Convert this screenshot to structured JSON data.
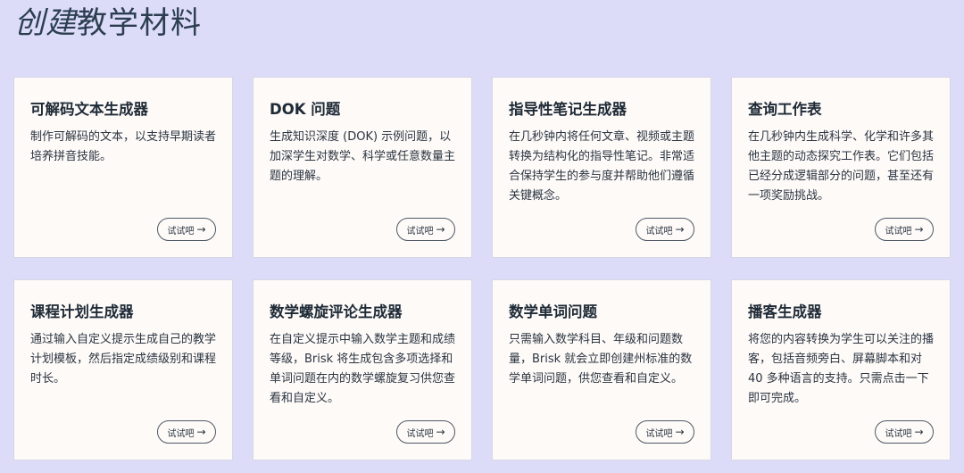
{
  "header": {
    "title_italic": "创建",
    "title_rest": "教学材料"
  },
  "cards": [
    {
      "title": "可解码文本生成器",
      "description": "制作可解码的文本，以支持早期读者培养拼音技能。",
      "button": "试试吧"
    },
    {
      "title": "DOK 问题",
      "description": "生成知识深度 (DOK) 示例问题，以加深学生对数学、科学或任意数量主题的理解。",
      "button": "试试吧"
    },
    {
      "title": "指导性笔记生成器",
      "description": "在几秒钟内将任何文章、视频或主题转换为结构化的指导性笔记。非常适合保持学生的参与度并帮助他们遵循关键概念。",
      "button": "试试吧"
    },
    {
      "title": "查询工作表",
      "description": "在几秒钟内生成科学、化学和许多其他主题的动态探究工作表。它们包括已经分成逻辑部分的问题，甚至还有一项奖励挑战。",
      "button": "试试吧"
    },
    {
      "title": "课程计划生成器",
      "description": "通过输入自定义提示生成自己的教学计划模板，然后指定成绩级别和课程时长。",
      "button": "试试吧"
    },
    {
      "title": "数学螺旋评论生成器",
      "description": "在自定义提示中输入数学主题和成绩等级，Brisk 将生成包含多项选择和单词问题在内的数学螺旋复习供您查看和自定义。",
      "button": "试试吧"
    },
    {
      "title": "数学单词问题",
      "description": "只需输入数学科目、年级和问题数量，Brisk 就会立即创建州标准的数学单词问题，供您查看和自定义。",
      "button": "试试吧"
    },
    {
      "title": "播客生成器",
      "description": "将您的内容转换为学生可以关注的播客，包括音频旁白、屏幕脚本和对 40 多种语言的支持。只需点击一下即可完成。",
      "button": "试试吧"
    }
  ],
  "icons": {
    "button_arrow": "arrow-right-icon"
  },
  "colors": {
    "background": "#dcdcf8",
    "card": "#fdfaf8",
    "title": "#2c3e50"
  }
}
